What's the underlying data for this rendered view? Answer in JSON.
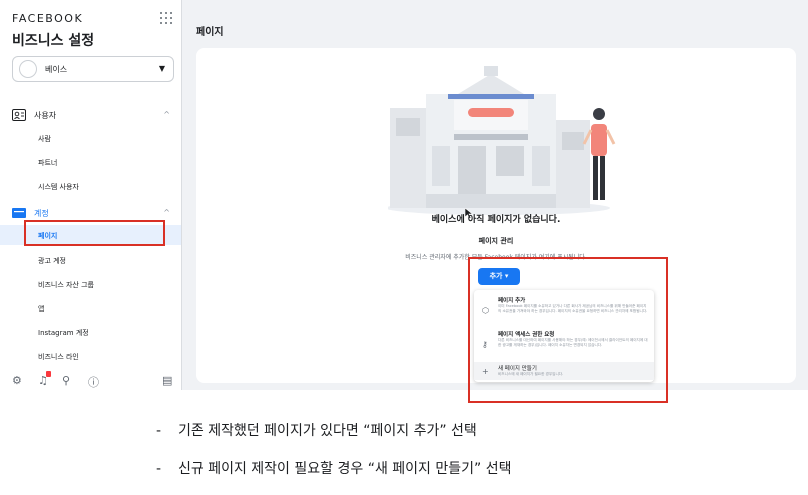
{
  "sidebar": {
    "brand": "FACEBOOK",
    "title": "비즈니스 설정",
    "business_selector": {
      "value": "베이스"
    },
    "sections": [
      {
        "label": "사용자",
        "icon": "users-icon",
        "items": [
          "사람",
          "파트너",
          "시스템 사용자"
        ]
      },
      {
        "label": "계정",
        "icon": "accounts-icon",
        "items": [
          "페이지",
          "광고 계정",
          "비즈니스 자산 그룹",
          "앱",
          "Instagram 계정",
          "비즈니스 라인"
        ]
      }
    ],
    "active_item": "페이지",
    "bottom_icons": [
      "settings-icon",
      "notifications-icon",
      "search-icon",
      "help-icon",
      "panel-toggle-icon"
    ]
  },
  "main": {
    "page_title": "페이지",
    "empty_state": {
      "title": "베이스에 아직 페이지가 없습니다.",
      "manage_title": "페이지 관리",
      "manage_desc": "비즈니스 관리자에 추가한 모든 Facebook 페이지가 여기에 표시됩니다."
    },
    "add_button": {
      "label": "추가",
      "caret": "▾"
    },
    "add_menu": [
      {
        "icon": "tag-icon",
        "label": "페이지 추가",
        "desc": "이미 Facebook 페이지를 소유하고 있거나 다른 회사가 제공님의 비즈니스를 위해 만들어준 페이지의 소유권을 가져와야 하는 경우입니다. 페이지의 소유권을 요청하면 비즈니스 관리자에 포함됩니다."
      },
      {
        "icon": "key-icon",
        "label": "페이지 액세스 권한 요청",
        "desc": "다른 비즈니스를 대신하여 페이지를 사용해야 하는 경우(예: 에이전시에서 클라이언트의 페이지에 대한 광고를 게재하는 경우)입니다. 페이지 소유자는 변경되지 않습니다."
      },
      {
        "icon": "plus-icon",
        "label": "새 페이지 만들기",
        "desc": "비즈니스에 새 페이지가 필요한 경우입니다."
      }
    ]
  },
  "captions": [
    {
      "dash": "-",
      "text": "기존 제작했던 페이지가 있다면 “페이지 추가” 선택"
    },
    {
      "dash": "-",
      "text": "신규 페이지 제작이 필요할 경우 “새 페이지 만들기” 선택"
    }
  ],
  "colors": {
    "accent": "#1877f2",
    "highlight": "#d93025",
    "illustration_accent": "#f2857a"
  }
}
